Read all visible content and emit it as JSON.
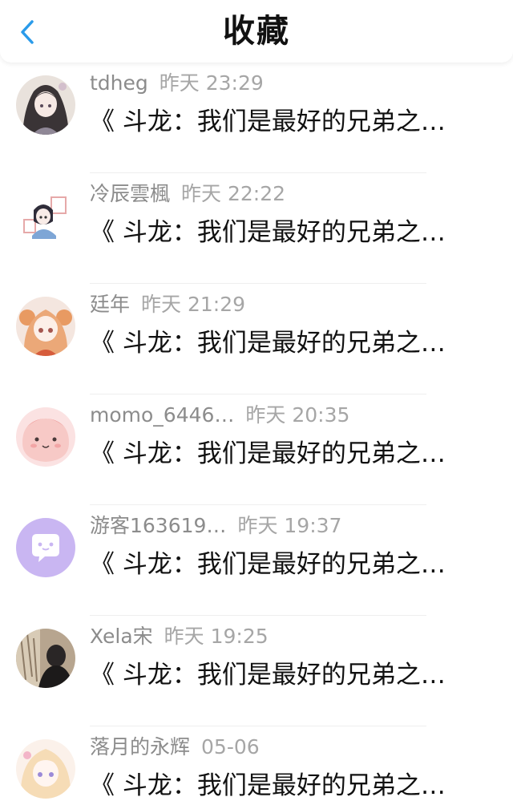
{
  "header": {
    "title": "收藏",
    "back_icon": "chevron-left-icon",
    "accent_color": "#2a9bea"
  },
  "items": [
    {
      "user": "tdheg",
      "time": "昨天 23:29",
      "message": "《 斗龙：我们是最好的兄弟之…",
      "avatar": "avatar-anime-girl-dark-hair"
    },
    {
      "user": "冷辰雲楓",
      "time": "昨天 22:22",
      "message": "《 斗龙：我们是最好的兄弟之…",
      "avatar": "avatar-chibi-character"
    },
    {
      "user": "廷年",
      "time": "昨天 21:29",
      "message": "《 斗龙：我们是最好的兄弟之…",
      "avatar": "avatar-girl-orange-hair"
    },
    {
      "user": "momo_6446…",
      "time": "昨天 20:35",
      "message": "《 斗龙：我们是最好的兄弟之…",
      "avatar": "avatar-pink-blob"
    },
    {
      "user": "游客163619…",
      "time": "昨天 19:37",
      "message": "《 斗龙：我们是最好的兄弟之…",
      "avatar": "avatar-purple-chat-bubble"
    },
    {
      "user": "Xela宋",
      "time": "昨天 19:25",
      "message": "《 斗龙：我们是最好的兄弟之…",
      "avatar": "avatar-photo-dark"
    },
    {
      "user": "落月的永辉",
      "time": "05-06",
      "message": "《 斗龙：我们是最好的兄弟之…",
      "avatar": "avatar-anime-girl-light-hair"
    }
  ]
}
